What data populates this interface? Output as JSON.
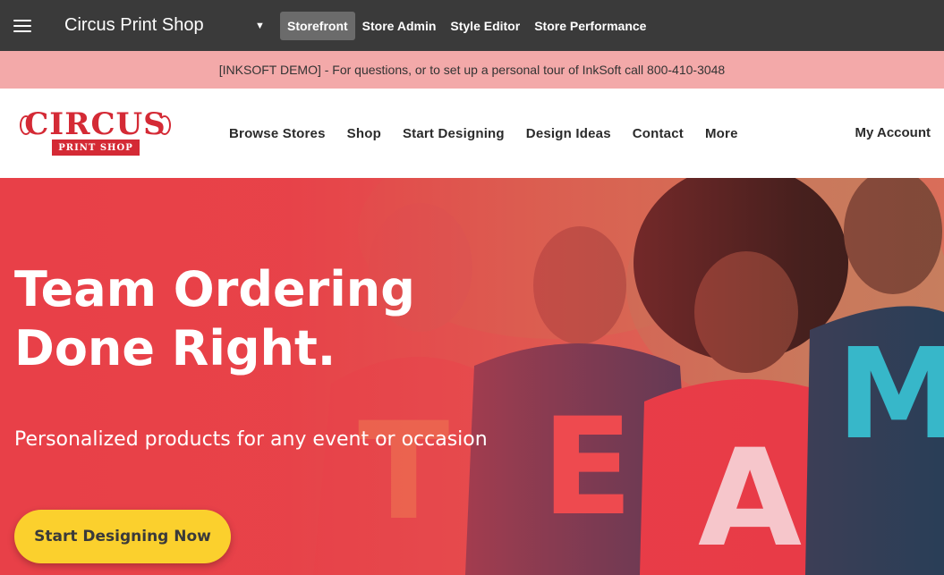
{
  "admin_bar": {
    "menu_icon": "hamburger-menu-icon",
    "store_title": "Circus Print Shop",
    "dropdown_icon": "caret-down-icon",
    "nav": [
      {
        "label": "Storefront",
        "active": true
      },
      {
        "label": "Store Admin",
        "active": false
      },
      {
        "label": "Style Editor",
        "active": false
      },
      {
        "label": "Store Performance",
        "active": false
      }
    ]
  },
  "demo_banner": {
    "text": "[INKSOFT DEMO] - For questions, or to set up a personal tour of InkSoft call 800-410-3048"
  },
  "header": {
    "logo": {
      "word": "CIRCUS",
      "ribbon": "PRINT SHOP"
    },
    "nav": [
      "Browse Stores",
      "Shop",
      "Start Designing",
      "Design Ideas",
      "Contact",
      "More"
    ],
    "account_label": "My Account"
  },
  "hero": {
    "title_line1": "Team Ordering",
    "title_line2": "Done Right.",
    "subtitle": "Personalized products for any event or occasion",
    "cta_label": "Start Designing Now",
    "shirt_letters": [
      "T",
      "E",
      "A",
      "M"
    ]
  },
  "colors": {
    "admin_bar": "#3a3a3a",
    "banner": "#f3a9a9",
    "brand_red": "#d42a35",
    "hero_red": "#e84048",
    "cta_yellow": "#fbd02d"
  }
}
